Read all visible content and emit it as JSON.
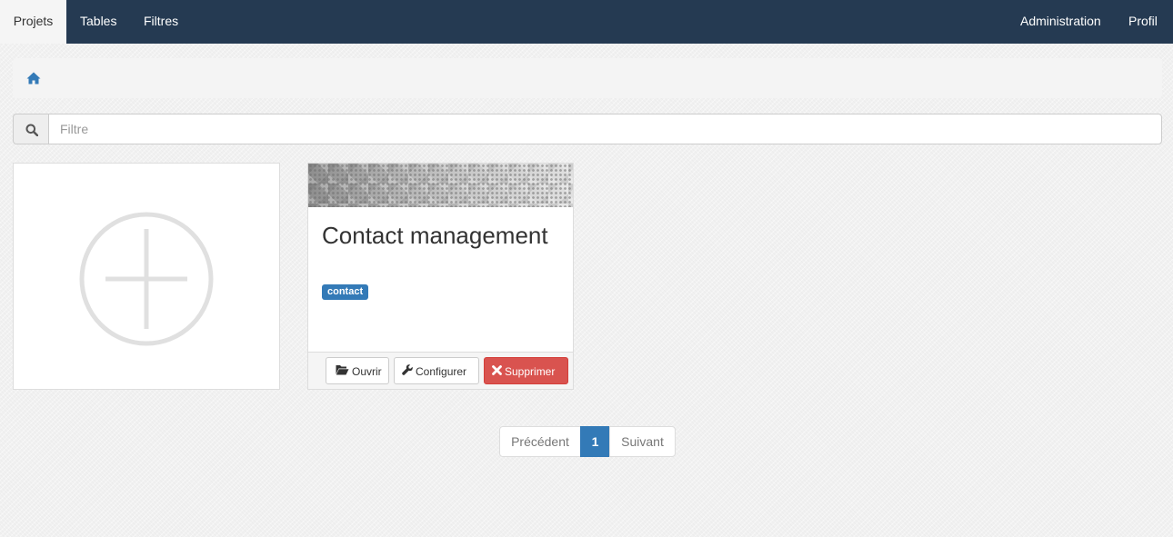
{
  "navbar": {
    "left_items": [
      {
        "label": "Projets"
      },
      {
        "label": "Tables"
      },
      {
        "label": "Filtres"
      }
    ],
    "right_items": [
      {
        "label": "Administration"
      },
      {
        "label": "Profil"
      }
    ]
  },
  "breadcrumb": {
    "home_icon": "home-icon"
  },
  "search": {
    "placeholder": "Filtre",
    "value": "",
    "icon": "search-icon"
  },
  "add_card": {
    "icon": "plus-circle-icon"
  },
  "projects": [
    {
      "title": "Contact management",
      "tags": [
        "contact"
      ],
      "actions": {
        "open_label": "Ouvrir",
        "configure_label": "Configurer",
        "delete_label": "Supprimer"
      }
    }
  ],
  "pagination": {
    "prev_label": "Précédent",
    "current_page": "1",
    "next_label": "Suivant"
  },
  "colors": {
    "navbar_bg": "#253a52",
    "primary": "#337ab7",
    "danger": "#d9534f"
  }
}
